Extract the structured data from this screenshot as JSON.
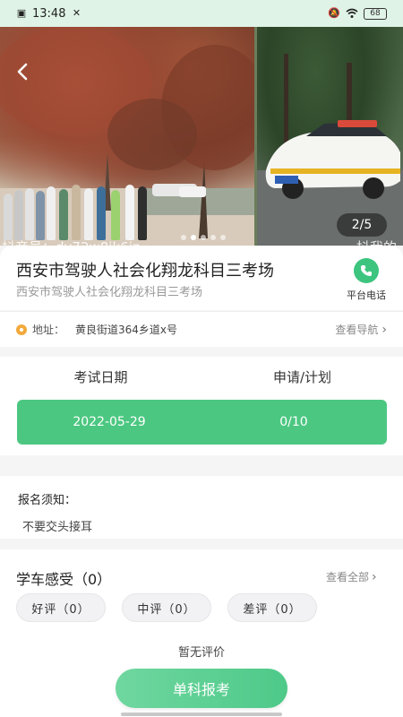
{
  "status_bar": {
    "time": "13:48",
    "battery": "68"
  },
  "gallery": {
    "counter": "2/5",
    "watermark_left": "抖音号：dy72w8ik6jz",
    "watermark_right": "抖我的"
  },
  "venue": {
    "title": "西安市驾驶人社会化翔龙科目三考场",
    "subtitle": "西安市驾驶人社会化翔龙科目三考场",
    "phone_label": "平台电话",
    "address_label": "地址：",
    "address": "黄良街道364乡道x号",
    "nav_label": "查看导航"
  },
  "exam": {
    "headers": [
      "考试日期",
      "申请/计划"
    ],
    "rows": [
      {
        "date": "2022-05-29",
        "ratio": "0/10"
      }
    ]
  },
  "notes": {
    "title": "报名须知：",
    "text": "不要交头接耳"
  },
  "reviews": {
    "title": "学车感受（0）",
    "view_all": "查看全部",
    "chips": [
      "好评（0）",
      "中评（0）",
      "差评（0）"
    ],
    "empty": "暂无评价"
  },
  "apply_button": "单科报考",
  "colors": {
    "accent": "#4cc781",
    "status_bg": "#dff3e6"
  }
}
